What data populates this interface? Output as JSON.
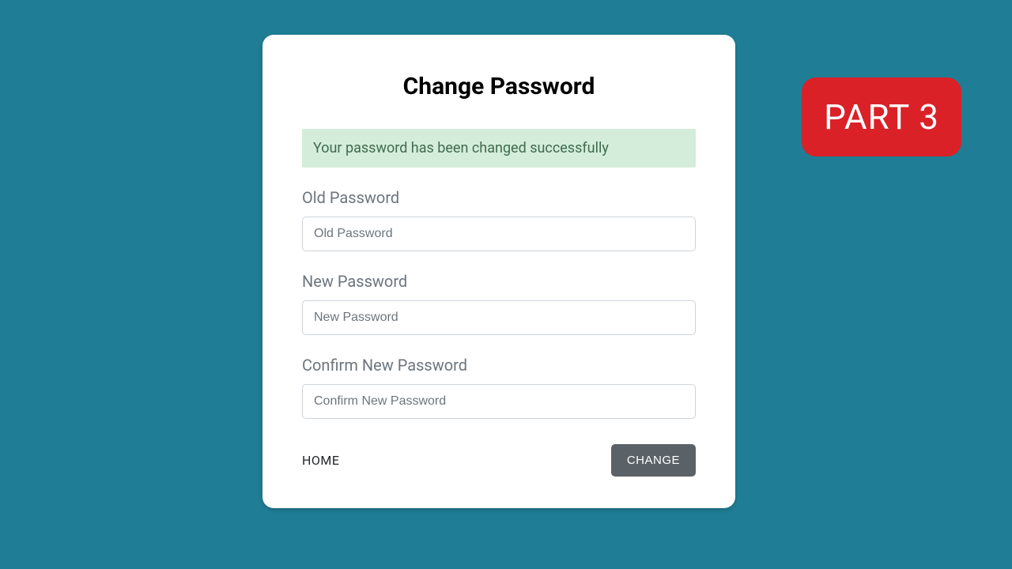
{
  "card": {
    "title": "Change Password",
    "alert": "Your password has been changed successfully",
    "fields": {
      "old": {
        "label": "Old Password",
        "placeholder": "Old Password"
      },
      "new": {
        "label": "New Password",
        "placeholder": "New Password"
      },
      "confirm": {
        "label": "Confirm New Password",
        "placeholder": "Confirm New Password"
      }
    },
    "actions": {
      "home": "HOME",
      "change": "CHANGE"
    }
  },
  "badge": {
    "text": "PART 3"
  },
  "colors": {
    "background": "#1f7e95",
    "badge": "#da2128",
    "alert_bg": "#d4edda",
    "button": "#5a6268"
  }
}
